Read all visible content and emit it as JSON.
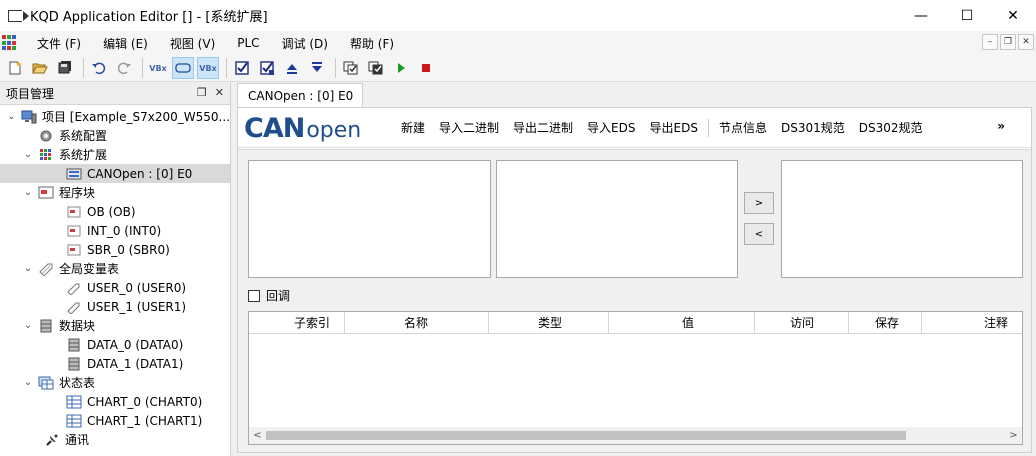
{
  "window": {
    "title": "KQD Application Editor [] - [系统扩展]",
    "minimize_glyph": "—",
    "maximize_glyph": "☐",
    "close_glyph": "✕"
  },
  "menubar": {
    "items": [
      "文件 (F)",
      "编辑 (E)",
      "视图 (V)",
      "PLC",
      "调试 (D)",
      "帮助 (F)"
    ]
  },
  "mdi": {
    "minimize": "–",
    "restore": "❐",
    "close": "✕"
  },
  "toolbar": {
    "vbx_label": "VBx"
  },
  "left_panel": {
    "title": "项目管理",
    "tree": [
      {
        "label": "项目 [Example_S7x200_W550...",
        "icon": "computer-icon",
        "level": 0,
        "expanded": true
      },
      {
        "label": "系统配置",
        "icon": "gear-icon",
        "level": 1
      },
      {
        "label": "系统扩展",
        "icon": "grid-icon",
        "level": 1,
        "expanded": true
      },
      {
        "label": "CANOpen : [0] E0",
        "icon": "module-icon",
        "level": 2,
        "selected": true
      },
      {
        "label": "程序块",
        "icon": "program-block-icon",
        "level": 1,
        "expanded": true
      },
      {
        "label": "OB (OB)",
        "icon": "block-icon",
        "level": 2
      },
      {
        "label": "INT_0 (INT0)",
        "icon": "block-icon",
        "level": 2
      },
      {
        "label": "SBR_0 (SBR0)",
        "icon": "block-icon",
        "level": 2
      },
      {
        "label": "全局变量表",
        "icon": "tag-icon",
        "level": 1,
        "expanded": true
      },
      {
        "label": "USER_0 (USER0)",
        "icon": "tag-icon",
        "level": 2
      },
      {
        "label": "USER_1 (USER1)",
        "icon": "tag-icon",
        "level": 2
      },
      {
        "label": "数据块",
        "icon": "database-icon",
        "level": 1,
        "expanded": true
      },
      {
        "label": "DATA_0 (DATA0)",
        "icon": "database-icon",
        "level": 2
      },
      {
        "label": "DATA_1 (DATA1)",
        "icon": "database-icon",
        "level": 2
      },
      {
        "label": "状态表",
        "icon": "chart-table-icon",
        "level": 1,
        "expanded": true
      },
      {
        "label": "CHART_0 (CHART0)",
        "icon": "table-icon",
        "level": 2
      },
      {
        "label": "CHART_1 (CHART1)",
        "icon": "table-icon",
        "level": 2
      },
      {
        "label": "通讯",
        "icon": "satellite-icon",
        "level": 1
      }
    ]
  },
  "document": {
    "tab_label": "CANOpen : [0] E0",
    "logo_can": "CAN",
    "logo_open": "open",
    "menu": [
      "新建",
      "导入二进制",
      "导出二进制",
      "导入EDS",
      "导出EDS"
    ],
    "menu2": [
      "节点信息",
      "DS301规范",
      "DS302规范"
    ],
    "more": "»",
    "move_right": ">",
    "move_left": "<",
    "callback_label": "回调",
    "columns": [
      "子索引",
      "名称",
      "类型",
      "值",
      "访问",
      "保存",
      "注释"
    ],
    "scroll_left": "<",
    "scroll_right": ">"
  },
  "colors": {
    "brand_blue": "#1f4e8c",
    "selection_gray": "#d9d9d9"
  }
}
